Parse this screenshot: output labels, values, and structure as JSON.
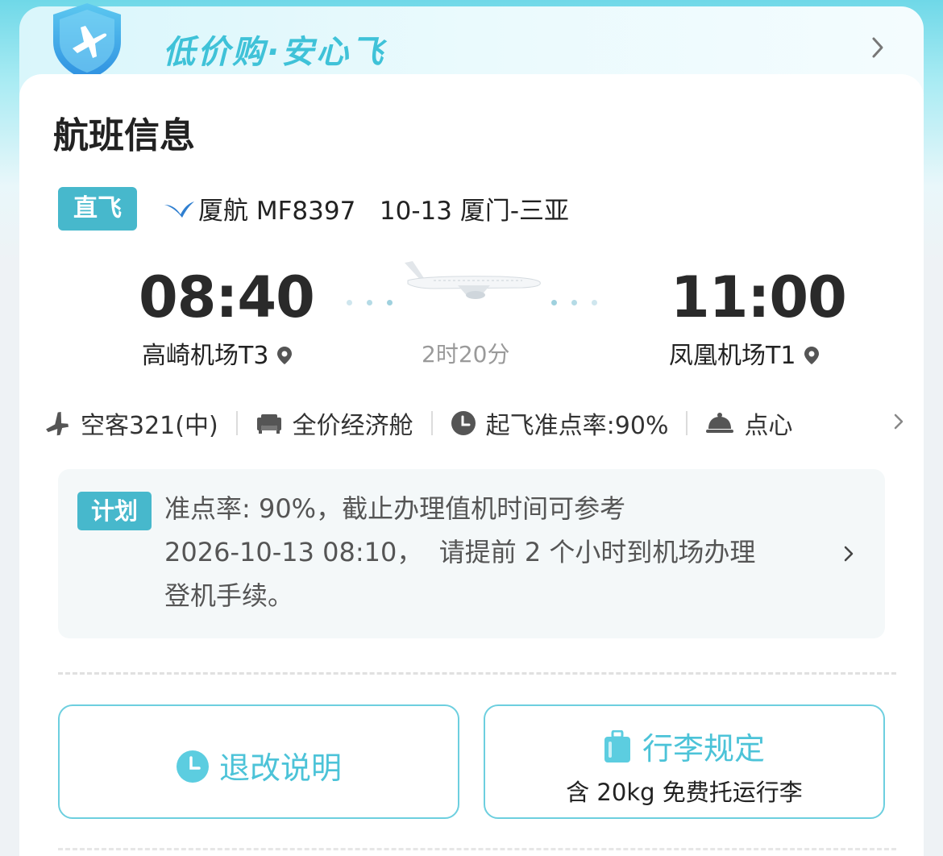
{
  "banner": {
    "slogan": "低价购·安心飞"
  },
  "card": {
    "title": "航班信息",
    "direct_label": "直飞",
    "airline": "厦航",
    "flight_no": "MF8397",
    "date_route": "10-13 厦门-三亚"
  },
  "flight": {
    "dep_time": "08:40",
    "arr_time": "11:00",
    "duration": "2时20分",
    "dep_airport": "高崎机场T3",
    "arr_airport": "凤凰机场T1"
  },
  "features": [
    {
      "icon": "plane-icon",
      "label": "空客321(中)"
    },
    {
      "icon": "seat-icon",
      "label": "全价经济舱"
    },
    {
      "icon": "clock-icon",
      "label": "起飞准点率:90%"
    },
    {
      "icon": "meal-icon",
      "label": "点心"
    }
  ],
  "notice": {
    "badge": "计划",
    "line1": "准点率: 90%，截止办理值机时间可参考",
    "line2": "2026-10-13 08:10，  请提前 2 个小时到机场办理",
    "line3": "登机手续。"
  },
  "actions": {
    "refund_label": "退改说明",
    "baggage_label": "行李规定",
    "baggage_sub": "含 20kg 免费托运行李"
  },
  "colors": {
    "accent": "#47b8cc",
    "accent_light": "#6dcfdf",
    "text": "#222222"
  }
}
